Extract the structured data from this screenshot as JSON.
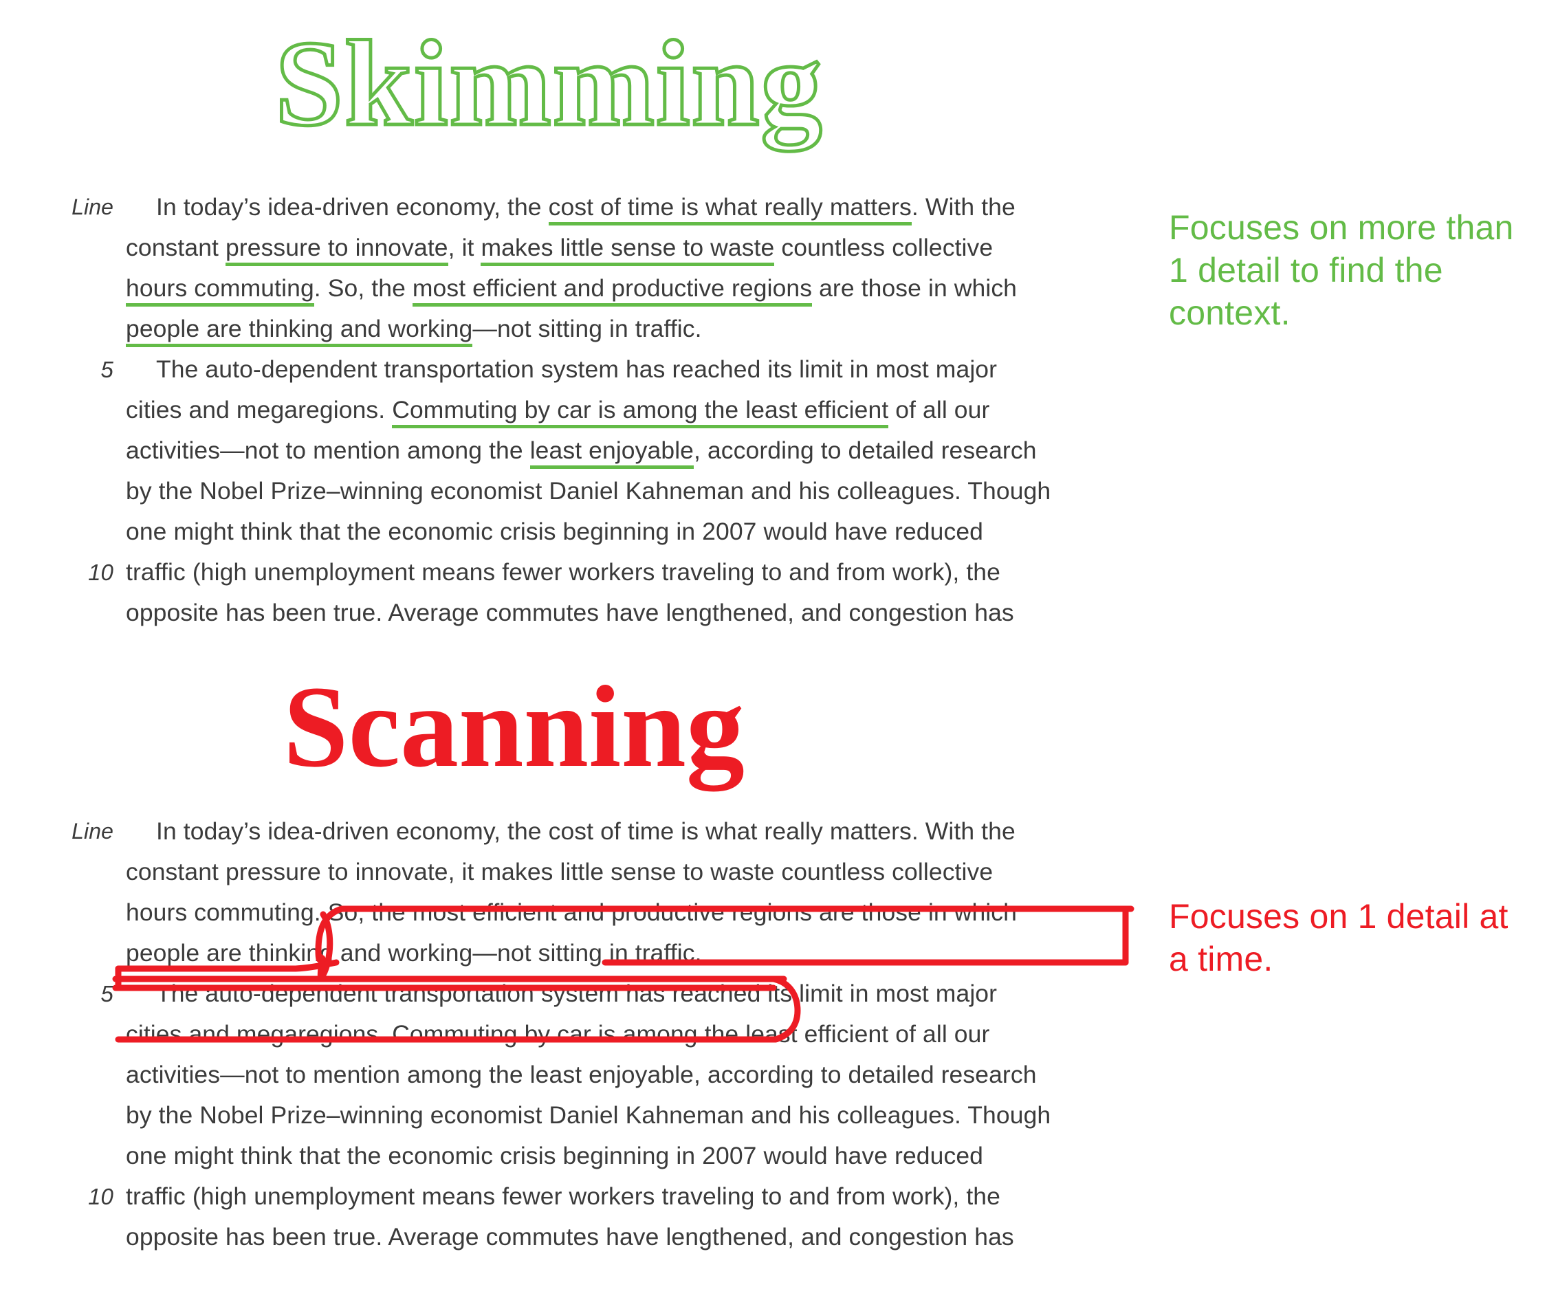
{
  "colors": {
    "green": "#63bb47",
    "red": "#ed1c24",
    "text": "#3b3b3b",
    "background": "#ffffff"
  },
  "skimming": {
    "title": "Skimming",
    "note": "Focuses on more than 1 detail to find the context.",
    "line_label": "Line",
    "line_numbers": {
      "five": "5",
      "ten": "10"
    },
    "lines": [
      {
        "num": "Line",
        "indent": true,
        "text": "In today’s idea-driven economy, the cost of time is what really matters. With the"
      },
      {
        "num": "",
        "indent": false,
        "text": "constant pressure to innovate, it makes little sense to waste countless collective"
      },
      {
        "num": "",
        "indent": false,
        "text": "hours commuting. So, the most efficient and productive regions are those in which"
      },
      {
        "num": "",
        "indent": false,
        "text": "people are thinking and working—not sitting in traffic."
      },
      {
        "num": "5",
        "indent": true,
        "text": "The auto-dependent transportation system has reached its limit in most major"
      },
      {
        "num": "",
        "indent": false,
        "text": "cities and megaregions. Commuting by car is among the least efficient of all our"
      },
      {
        "num": "",
        "indent": false,
        "text": "activities—not to mention among the least enjoyable, according to detailed research"
      },
      {
        "num": "",
        "indent": false,
        "text": "by the Nobel Prize–winning economist Daniel Kahneman and his colleagues. Though"
      },
      {
        "num": "",
        "indent": false,
        "text": "one might think that the economic crisis beginning in 2007 would have reduced"
      },
      {
        "num": "10",
        "indent": false,
        "text": "traffic (high unemployment means fewer workers traveling to and from work), the"
      },
      {
        "num": "",
        "indent": false,
        "text": "opposite has been true. Average commutes have lengthened, and congestion has"
      }
    ],
    "underlined_phrases": [
      "cost of time is what really matters",
      "pressure to innovate",
      "makes little sense to waste",
      "hours commuting",
      "most efficient and productive regions",
      "people are thinking and working",
      "Commuting by car is among the least efficient",
      "least enjoyable"
    ]
  },
  "scanning": {
    "title": "Scanning",
    "note": "Focuses on 1 detail at a time.",
    "line_label": "Line",
    "line_numbers": {
      "five": "5",
      "ten": "10"
    },
    "lines": [
      {
        "num": "Line",
        "indent": true,
        "text": "In today’s idea-driven economy, the cost of time is what really matters. With the"
      },
      {
        "num": "",
        "indent": false,
        "text": "constant pressure to innovate, it makes little sense to waste countless collective"
      },
      {
        "num": "",
        "indent": false,
        "text": "hours commuting. So, the most efficient and productive regions are those in which"
      },
      {
        "num": "",
        "indent": false,
        "text": "people are thinking and working—not sitting in traffic."
      },
      {
        "num": "5",
        "indent": true,
        "text": "The auto-dependent transportation system has reached its limit in most major"
      },
      {
        "num": "",
        "indent": false,
        "text": "cities and megaregions. Commuting by car is among the least efficient of all our"
      },
      {
        "num": "",
        "indent": false,
        "text": "activities—not to mention among the least enjoyable, according to detailed research"
      },
      {
        "num": "",
        "indent": false,
        "text": "by the Nobel Prize–winning economist Daniel Kahneman and his colleagues. Though"
      },
      {
        "num": "",
        "indent": false,
        "text": "one might think that the economic crisis beginning in 2007 would have reduced"
      },
      {
        "num": "10",
        "indent": false,
        "text": "traffic (high unemployment means fewer workers traveling to and from work), the"
      },
      {
        "num": "",
        "indent": false,
        "text": "opposite has been true. Average commutes have lengthened, and congestion has"
      }
    ],
    "circled_sentence": "So, the most efficient and productive regions are those in which people are thinking and working—not sitting in traffic."
  }
}
